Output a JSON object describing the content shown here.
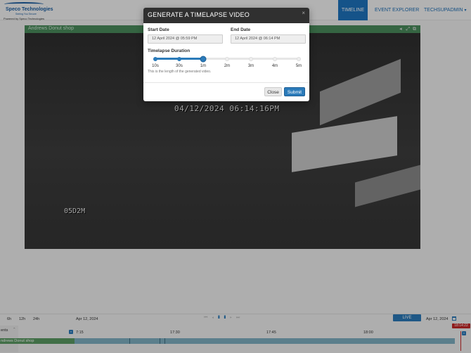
{
  "header": {
    "brand": "Speco Technologies",
    "tagline": "Seeing You Secure",
    "powered_by": "Powered by Speco Technologies",
    "nav": [
      {
        "label": "TIMELINE",
        "active": true
      },
      {
        "label": "EVENT EXPLORER",
        "active": false
      },
      {
        "label": "TECHSUPADMIN",
        "active": false
      }
    ]
  },
  "camera": {
    "name": "Andrews Donut shop",
    "osd_time": "04/12/2024 06:14:16PM",
    "osd_label": "05D2M"
  },
  "modal": {
    "title": "GENERATE A TIMELAPSE VIDEO",
    "close_glyph": "×",
    "start_label": "Start Date",
    "start_value": "12 April 2024 @ 05:59 PM",
    "end_label": "End Date",
    "end_value": "12 April 2024 @ 06:14 PM",
    "duration_label": "Timelapse Duration",
    "duration_options": [
      "10s",
      "30s",
      "1m",
      "2m",
      "3m",
      "4m",
      "5m"
    ],
    "selected_index": 2,
    "help_text": "This is the length of the generated video.",
    "close_button": "Close",
    "submit_button": "Submit"
  },
  "timeline": {
    "ranges": [
      "6h",
      "12h",
      "24h"
    ],
    "date_left": "Apr 12, 2024",
    "live_label": "LIVE",
    "date_right": "Apr 12, 2024",
    "events_label": "ents",
    "times": [
      "7:15",
      "17:30",
      "17:45",
      "18:00"
    ],
    "now_badge": "18:14:22",
    "camera_row": "ndrews Donut shop"
  },
  "colors": {
    "accent": "#1e73be",
    "header_bg": "#303030",
    "camera_green": "#4a8c5c",
    "timeline_bar": "#7fb0c2",
    "now_red": "#c62828"
  }
}
